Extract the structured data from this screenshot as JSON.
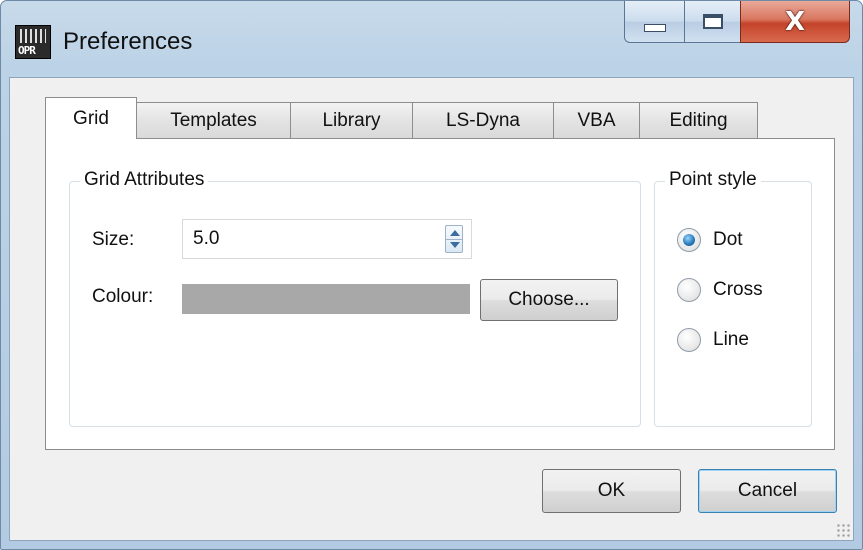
{
  "window": {
    "title": "Preferences",
    "icon_text": "OPR",
    "controls": {
      "minimize": "minimize-icon",
      "maximize": "maximize-icon",
      "close": "close-icon"
    }
  },
  "tabs": [
    {
      "label": "Grid",
      "active": true
    },
    {
      "label": "Templates",
      "active": false
    },
    {
      "label": "Library",
      "active": false
    },
    {
      "label": "LS-Dyna",
      "active": false
    },
    {
      "label": "VBA",
      "active": false
    },
    {
      "label": "Editing",
      "active": false
    }
  ],
  "grid_attributes": {
    "group_label": "Grid Attributes",
    "size_label": "Size:",
    "size_value": "5.0",
    "colour_label": "Colour:",
    "colour_value": "#a8a8a8",
    "choose_label": "Choose..."
  },
  "point_style": {
    "group_label": "Point style",
    "options": [
      {
        "label": "Dot",
        "checked": true
      },
      {
        "label": "Cross",
        "checked": false
      },
      {
        "label": "Line",
        "checked": false
      }
    ]
  },
  "footer": {
    "ok_label": "OK",
    "cancel_label": "Cancel"
  }
}
